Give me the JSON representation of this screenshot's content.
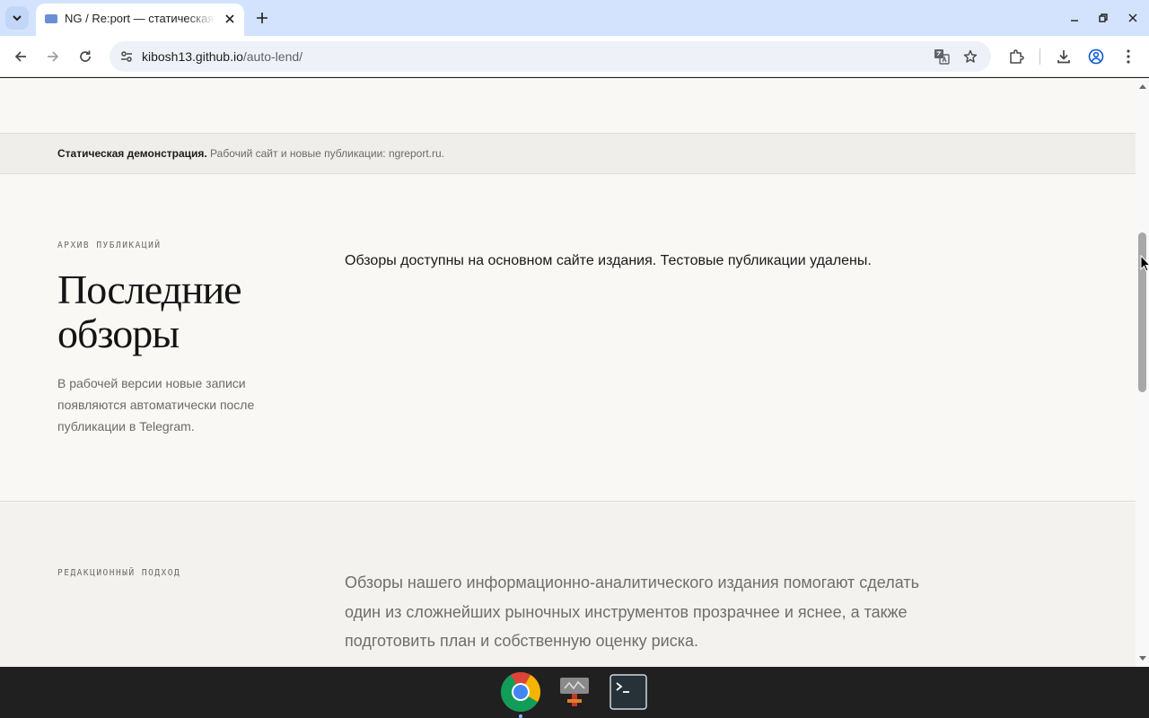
{
  "browser": {
    "tab_title": "NG / Re:port — статическая демонстрация",
    "url_host": "kibosh13.github.io",
    "url_path": "/auto-lend/"
  },
  "page": {
    "notice_bold": "Статическая демонстрация.",
    "notice_rest": " Рабочий сайт и новые публикации: ngreport.ru.",
    "archive": {
      "eyebrow": "АРХИВ ПУБЛИКАЦИЙ",
      "title_line1": "Последние",
      "title_line2": "обзоры",
      "side_note": "В рабочей версии новые записи появляются автоматически после публикации в Telegram.",
      "main_text": "Обзоры доступны на основном сайте издания. Тестовые публикации удалены."
    },
    "editorial": {
      "eyebrow": "РЕДАКЦИОННЫЙ ПОДХОД",
      "lead": "Обзоры нашего информационно-аналитического издания помогают сделать один из сложнейших рыночных инструментов прозрачнее и яснее, а также подготовить план и собственную оценку риска."
    }
  },
  "colors": {
    "tabstrip": "#d3e3fd",
    "page_bg": "#f9f8f5",
    "notice_bg": "#efeeeb",
    "shelf": "#202020"
  },
  "icons": {
    "tab_search": "chevron-down-icon",
    "back": "arrow-left-icon",
    "forward": "arrow-right-icon",
    "reload": "reload-icon",
    "site_info": "tune-icon",
    "translate": "translate-icon",
    "bookmark": "star-icon",
    "extensions": "puzzle-icon",
    "downloads": "download-icon",
    "profile": "account-icon",
    "menu": "kebab-menu-icon"
  }
}
